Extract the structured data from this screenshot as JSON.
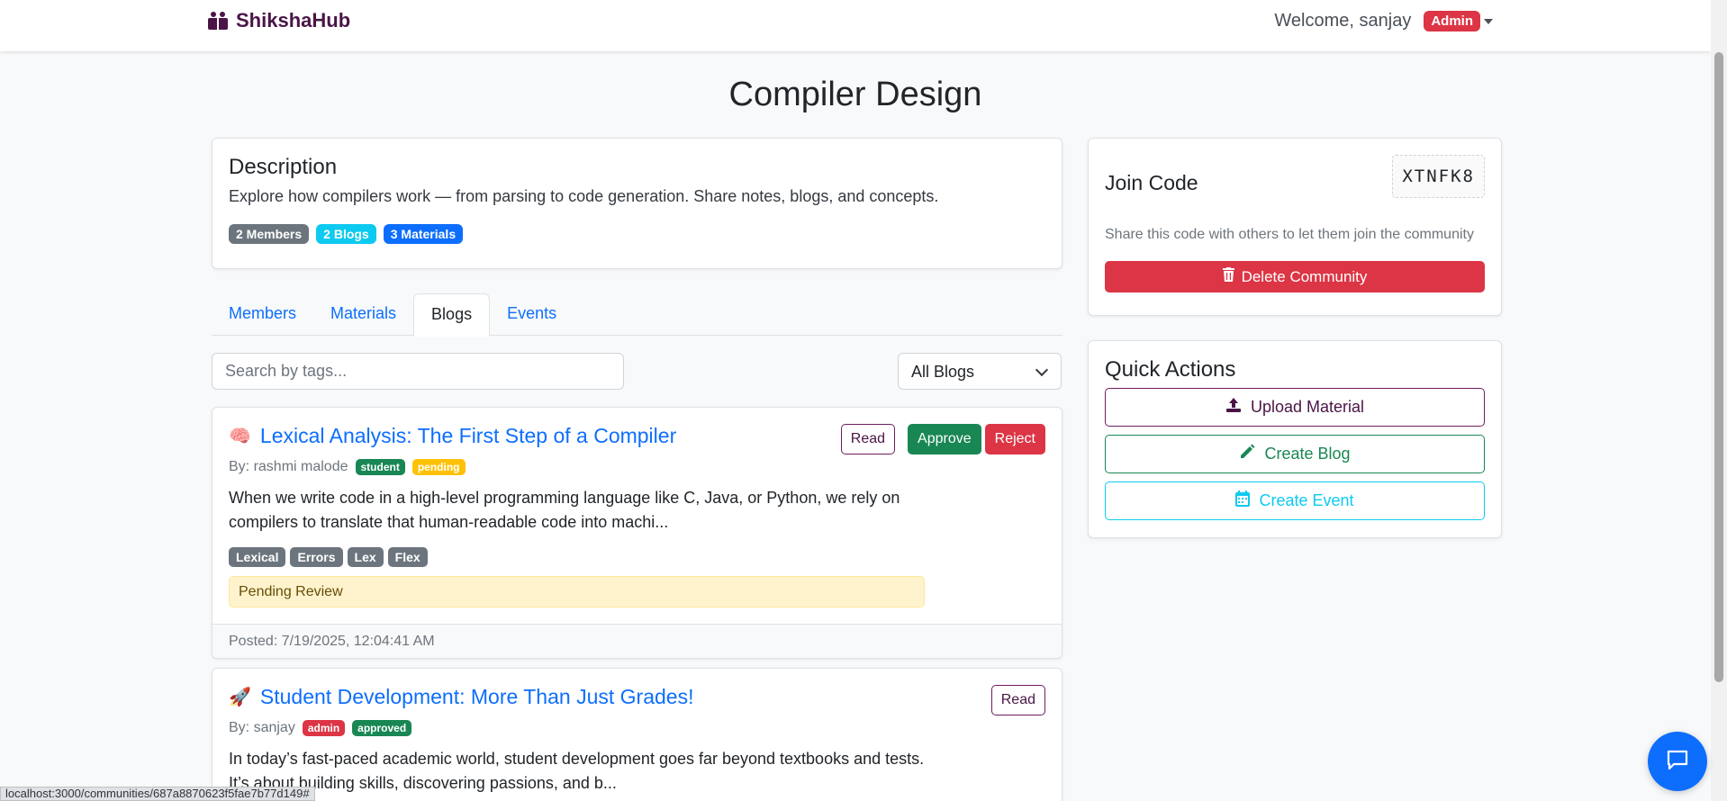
{
  "navbar": {
    "brand": "ShikshaHub",
    "welcome": "Welcome, sanjay",
    "role_badge": "Admin"
  },
  "page": {
    "title": "Compiler Design"
  },
  "description": {
    "heading": "Description",
    "text": "Explore how compilers work — from parsing to code generation. Share notes, blogs, and concepts.",
    "badges": [
      "2 Members",
      "2 Blogs",
      "3 Materials"
    ]
  },
  "tabs": [
    {
      "label": "Members",
      "active": false
    },
    {
      "label": "Materials",
      "active": false
    },
    {
      "label": "Blogs",
      "active": true
    },
    {
      "label": "Events",
      "active": false
    }
  ],
  "filters": {
    "search_placeholder": "Search by tags...",
    "select_value": "All Blogs"
  },
  "blogs": [
    {
      "emoji": "🧠",
      "title": "Lexical Analysis: The First Step of a Compiler",
      "author": "By: rashmi malode",
      "role": "student",
      "status": "pending",
      "excerpt_line1": "When we write code in a high-level programming language like C, Java, or Python, we rely on",
      "excerpt_line2": "compilers to translate that human-readable code into machi...",
      "tags": [
        "Lexical",
        "Errors",
        "Lex",
        "Flex"
      ],
      "alert": "Pending Review",
      "posted": "Posted: 7/19/2025, 12:04:41 AM",
      "read_label": "Read",
      "approve_label": "Approve",
      "reject_label": "Reject"
    },
    {
      "emoji": "🚀",
      "title": "Student Development: More Than Just Grades!",
      "author": "By: sanjay",
      "role": "admin",
      "status": "approved",
      "excerpt_line1": "In today’s fast-paced academic world, student development goes far beyond textbooks and tests.",
      "excerpt_line2": "It’s about building skills, discovering passions, and b...",
      "read_label": "Read"
    }
  ],
  "join": {
    "heading": "Join Code",
    "code": "XTNFK8",
    "help": "Share this code with others to let them join the community",
    "delete_label": "Delete Community"
  },
  "quick_actions": {
    "heading": "Quick Actions",
    "upload_label": "Upload Material",
    "blog_label": "Create Blog",
    "event_label": "Create Event"
  },
  "status_bar": {
    "url": "localhost:3000/communities/687a8870623f5fae7b77d149#"
  },
  "colors": {
    "brand": "#4a1546",
    "primary": "#0d6efd",
    "danger": "#dc3545",
    "success": "#198754",
    "info": "#0dcaf0",
    "warning": "#ffc107"
  }
}
